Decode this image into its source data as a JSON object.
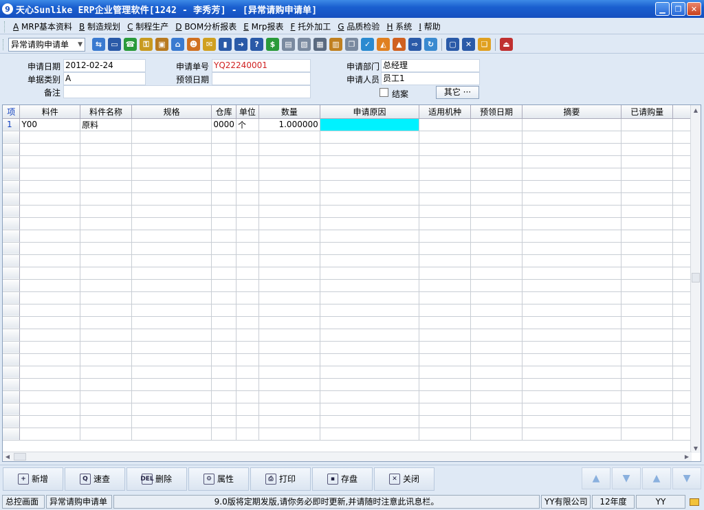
{
  "window": {
    "title": "天心Sunlike ERP企业管理软件[1242 - 李秀芳] - [异常请购申请单]",
    "controls": {
      "minimize": "▁",
      "restore": "❐",
      "close": "✕"
    }
  },
  "menu": [
    {
      "key": "A",
      "label": "MRP基本资料"
    },
    {
      "key": "B",
      "label": "制造规划"
    },
    {
      "key": "C",
      "label": "制程生产"
    },
    {
      "key": "D",
      "label": "BOM分析报表"
    },
    {
      "key": "E",
      "label": "Mrp报表"
    },
    {
      "key": "F",
      "label": "托外加工"
    },
    {
      "key": "G",
      "label": "品质检验"
    },
    {
      "key": "H",
      "label": "系统"
    },
    {
      "key": "I",
      "label": "帮助"
    }
  ],
  "toolbar": {
    "doc_selector": "异常请购申请单",
    "icons": [
      {
        "name": "tree-icon",
        "color": "#3a7ad0",
        "glyph": "⇆"
      },
      {
        "name": "monitor-icon",
        "color": "#2a5aa8",
        "glyph": "▭"
      },
      {
        "name": "phone-icon",
        "color": "#2a9a3a",
        "glyph": "☎"
      },
      {
        "name": "key-icon",
        "color": "#c89a20",
        "glyph": "⚿"
      },
      {
        "name": "briefcase-icon",
        "color": "#b87a20",
        "glyph": "▣"
      },
      {
        "name": "home-icon",
        "color": "#3a7ad0",
        "glyph": "⌂"
      },
      {
        "name": "users-icon",
        "color": "#d07020",
        "glyph": "☻"
      },
      {
        "name": "mail-icon",
        "color": "#d0a020",
        "glyph": "✉"
      },
      {
        "name": "bookmark-icon",
        "color": "#2a5aa8",
        "glyph": "▮"
      },
      {
        "name": "arrow-right-icon",
        "color": "#2a5aa8",
        "glyph": "➜"
      },
      {
        "name": "help-icon",
        "color": "#2a5aa8",
        "glyph": "?"
      },
      {
        "name": "dollar-icon",
        "color": "#2a9a3a",
        "glyph": "$"
      },
      {
        "name": "cart-icon",
        "color": "#7a8aa0",
        "glyph": "▤"
      },
      {
        "name": "report-icon",
        "color": "#7a8aa0",
        "glyph": "▧"
      },
      {
        "name": "calculator-icon",
        "color": "#5a6a80",
        "glyph": "▦"
      },
      {
        "name": "cabinet-icon",
        "color": "#c08020",
        "glyph": "▥"
      },
      {
        "name": "copy-icon",
        "color": "#7a8aa0",
        "glyph": "❐"
      },
      {
        "name": "check-icon",
        "color": "#2a8ad0",
        "glyph": "✓"
      },
      {
        "name": "bell-icon",
        "color": "#e08020",
        "glyph": "◭"
      },
      {
        "name": "pyramid-icon",
        "color": "#d06020",
        "glyph": "▲"
      },
      {
        "name": "screen-arrow-icon",
        "color": "#2a5aa8",
        "glyph": "⇨"
      },
      {
        "name": "refresh-icon",
        "color": "#3a8ad0",
        "glyph": "↻"
      },
      {
        "name": "window-icon",
        "color": "#2a5aa8",
        "glyph": "▢"
      },
      {
        "name": "close-window-icon",
        "color": "#2a5aa8",
        "glyph": "✕"
      },
      {
        "name": "cascade-icon",
        "color": "#e0a020",
        "glyph": "❏"
      },
      {
        "name": "exit-icon",
        "color": "#c03030",
        "glyph": "⏏"
      }
    ]
  },
  "form": {
    "apply_date_label": "申请日期",
    "apply_date": "2012-02-24",
    "apply_no_label": "申请单号",
    "apply_no": "YQ22240001",
    "dept_label": "申请部门",
    "dept": "总经理",
    "doc_type_label": "单据类别",
    "doc_type": "A",
    "expected_date_label": "预领日期",
    "expected_date": "",
    "applicant_label": "申请人员",
    "applicant": "员工1",
    "remark_label": "备注",
    "remark": "",
    "closed_label": "结案",
    "more_button": "其它 ···"
  },
  "grid": {
    "columns": [
      "项",
      "料件",
      "料件名称",
      "规格",
      "仓库",
      "单位",
      "数量",
      "申请原因",
      "适用机种",
      "预领日期",
      "摘要",
      "已请购量"
    ],
    "rows": [
      [
        "1",
        "Y00",
        "原料",
        "",
        "0000",
        "个",
        "1.000000",
        "",
        "",
        "",
        "",
        ""
      ]
    ]
  },
  "actions": [
    {
      "name": "add-button",
      "icon": "+",
      "label": "新增"
    },
    {
      "name": "search-button",
      "icon": "Q",
      "label": "速查"
    },
    {
      "name": "delete-button",
      "icon": "DEL",
      "label": "删除"
    },
    {
      "name": "properties-button",
      "icon": "⚙",
      "label": "属性"
    },
    {
      "name": "print-button",
      "icon": "⎙",
      "label": "打印"
    },
    {
      "name": "save-button",
      "icon": "▪",
      "label": "存盘"
    },
    {
      "name": "close-button",
      "icon": "✕",
      "label": "关闭"
    }
  ],
  "nav": {
    "first": "▲",
    "prev": "▼",
    "next": "▲",
    "last": "▼"
  },
  "status": {
    "console": "总控画面",
    "current": "异常请购申请单",
    "message": "9.0版将定期发版,请你务必即时更新,并请随时注意此讯息栏。",
    "company": "YY有限公司",
    "year": "12年度",
    "user": "YY"
  }
}
